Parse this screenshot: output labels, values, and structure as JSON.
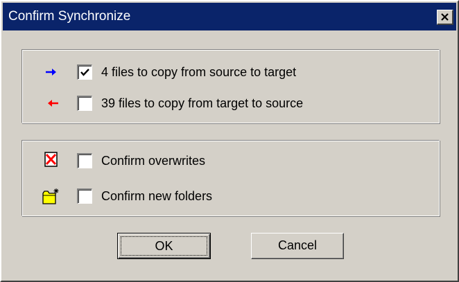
{
  "window": {
    "title": "Confirm Synchronize",
    "close_icon": "close-icon"
  },
  "transfer": {
    "items": [
      {
        "icon": "right-arrow-icon",
        "icon_color": "#0000ff",
        "checked": true,
        "label": "4 files to copy from source to target"
      },
      {
        "icon": "left-arrow-icon",
        "icon_color": "#ff0000",
        "checked": false,
        "label": "39 files to copy from target to source"
      }
    ]
  },
  "confirm": {
    "items": [
      {
        "icon": "overwrite-x-icon",
        "checked": false,
        "label": "Confirm overwrites"
      },
      {
        "icon": "new-folder-icon",
        "checked": false,
        "label": "Confirm new folders"
      }
    ]
  },
  "buttons": {
    "ok_label": "OK",
    "cancel_label": "Cancel"
  }
}
